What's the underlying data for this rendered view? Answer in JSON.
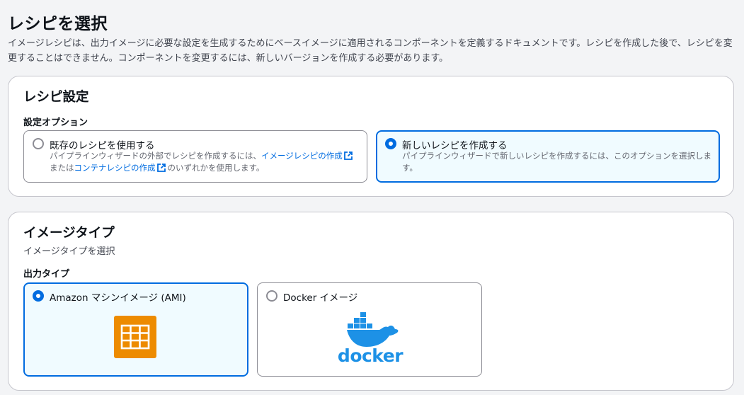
{
  "page": {
    "title": "レシピを選択",
    "description": "イメージレシピは、出力イメージに必要な設定を生成するためにベースイメージに適用されるコンポーネントを定義するドキュメントです。レシピを作成した後で、レシピを変更することはできません。コンポーネントを変更するには、新しいバージョンを作成する必要があります。"
  },
  "recipe_settings": {
    "heading": "レシピ設定",
    "options_label": "設定オプション",
    "options": [
      {
        "title": "既存のレシピを使用する",
        "desc_before": "パイプラインウィザードの外部でレシピを作成するには、",
        "link1": "イメージレシピの作成",
        "desc_mid": "または",
        "link2": "コンテナレシピの作成",
        "desc_after": "のいずれかを使用します。",
        "selected": false
      },
      {
        "title": "新しいレシピを作成する",
        "desc": "パイプラインウィザードで新しいレシピを作成するには、このオプションを選択します。",
        "selected": true
      }
    ]
  },
  "image_type": {
    "heading": "イメージタイプ",
    "description": "イメージタイプを選択",
    "output_label": "出力タイプ",
    "options": [
      {
        "title": "Amazon マシンイメージ (AMI)",
        "icon": "ami-icon",
        "selected": true
      },
      {
        "title": "Docker イメージ",
        "icon": "docker-logo",
        "logo_text": "docker",
        "selected": false
      }
    ]
  },
  "colors": {
    "accent": "#006ce0",
    "selected_bg": "#f0fbff",
    "ami_orange": "#ed8b00",
    "docker_blue": "#1d91e6"
  }
}
